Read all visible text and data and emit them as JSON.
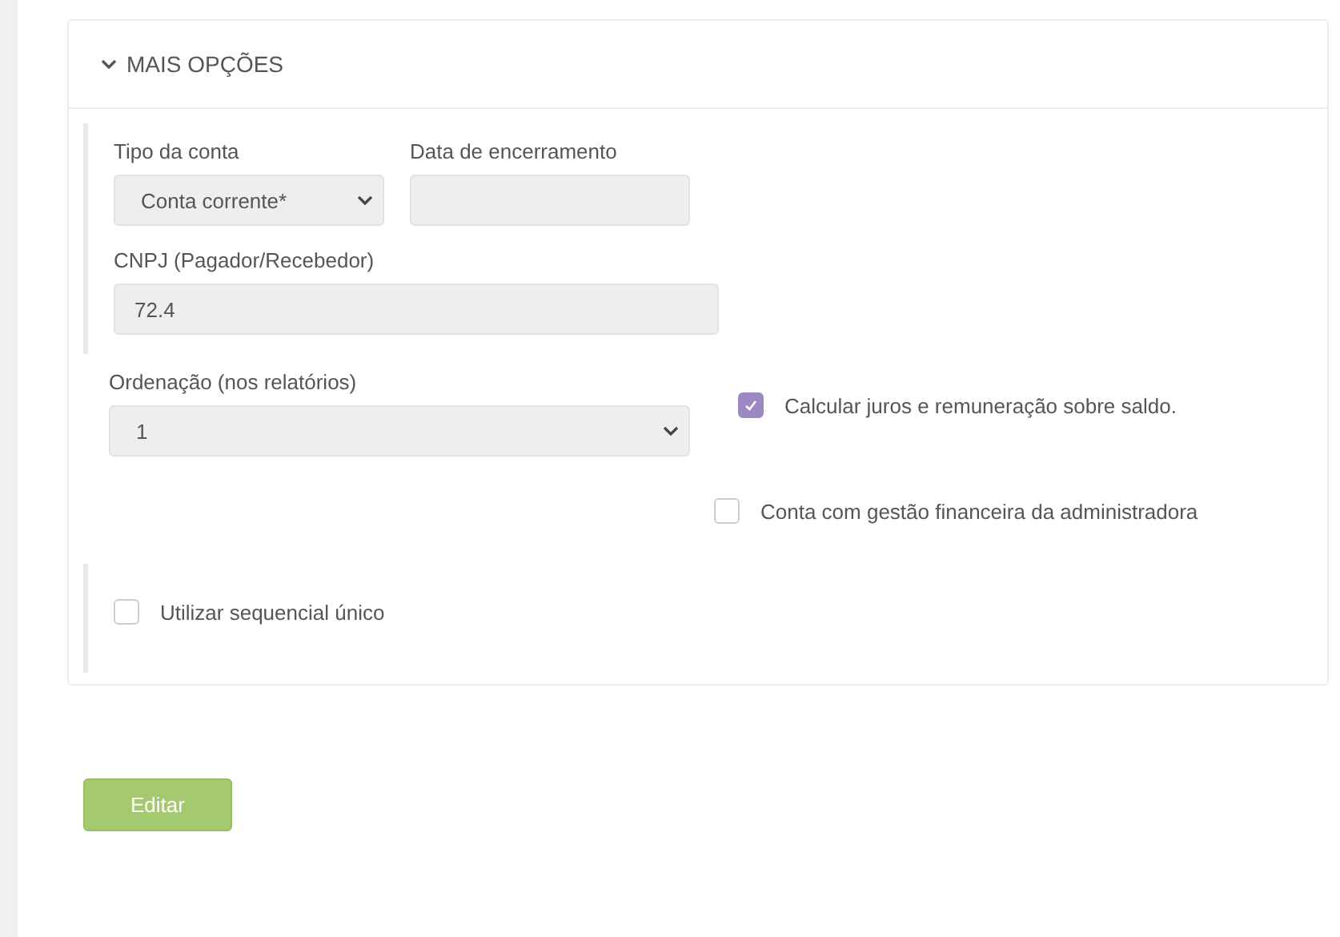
{
  "section": {
    "title": "MAIS OPÇÕES",
    "expanded": true
  },
  "account_type": {
    "label": "Tipo da conta",
    "value": "Conta corrente*"
  },
  "closing_date": {
    "label": "Data de encerramento"
  },
  "cnpj": {
    "label": "CNPJ (Pagador/Recebedor)",
    "value": "72.4"
  },
  "ordering": {
    "label": "Ordenação (nos relatórios)",
    "value": "1"
  },
  "checkboxes": [
    {
      "label": "Calcular juros e remuneração sobre saldo.",
      "checked": true
    },
    {
      "label": "Conta com gestão financeira da administradora",
      "checked": false
    },
    {
      "label": "Utilizar sequencial único",
      "checked": false
    }
  ],
  "buttons": [
    {
      "label": "Editar"
    }
  ]
}
